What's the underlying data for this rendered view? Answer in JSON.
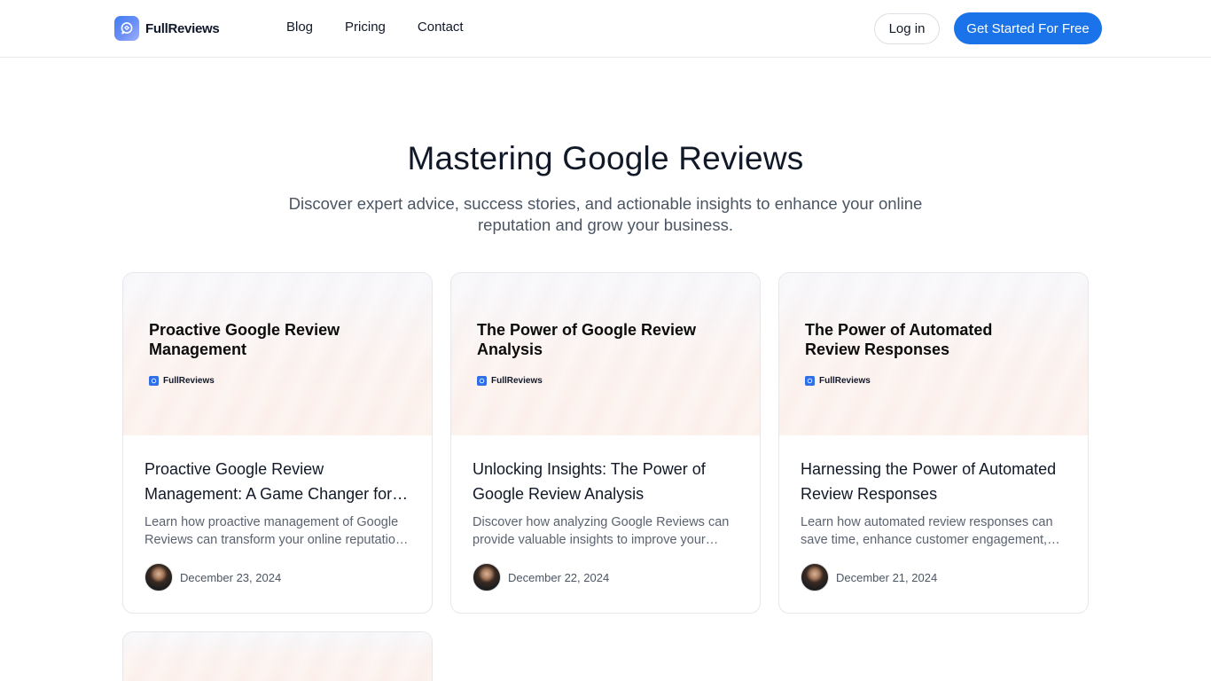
{
  "header": {
    "brand": "FullReviews",
    "nav": [
      {
        "label": "Blog"
      },
      {
        "label": "Pricing"
      },
      {
        "label": "Contact"
      }
    ],
    "login_label": "Log in",
    "cta_label": "Get Started For Free",
    "cta_color": "#1a73e8"
  },
  "hero": {
    "title": "Mastering Google Reviews",
    "subtitle": "Discover expert advice, success stories, and actionable insights to enhance your online reputation and grow your business."
  },
  "posts": [
    {
      "thumb_title": "Proactive Google Review Management",
      "thumb_brand": "FullReviews",
      "title": "Proactive Google Review Management: A Game Changer for Your Business",
      "excerpt": "Learn how proactive management of Google Reviews can transform your online reputation and drive growth.",
      "date": "December 23, 2024"
    },
    {
      "thumb_title": "The Power of Google Review Analysis",
      "thumb_brand": "FullReviews",
      "title": "Unlocking Insights: The Power of Google Review Analysis",
      "excerpt": "Discover how analyzing Google Reviews can provide valuable insights to improve your business.",
      "date": "December 22, 2024"
    },
    {
      "thumb_title": "The Power of Automated Review Responses",
      "thumb_brand": "FullReviews",
      "title": "Harnessing the Power of Automated Review Responses",
      "excerpt": "Learn how automated review responses can save time, enhance customer engagement, and boost your reputation.",
      "date": "December 21, 2024"
    }
  ]
}
